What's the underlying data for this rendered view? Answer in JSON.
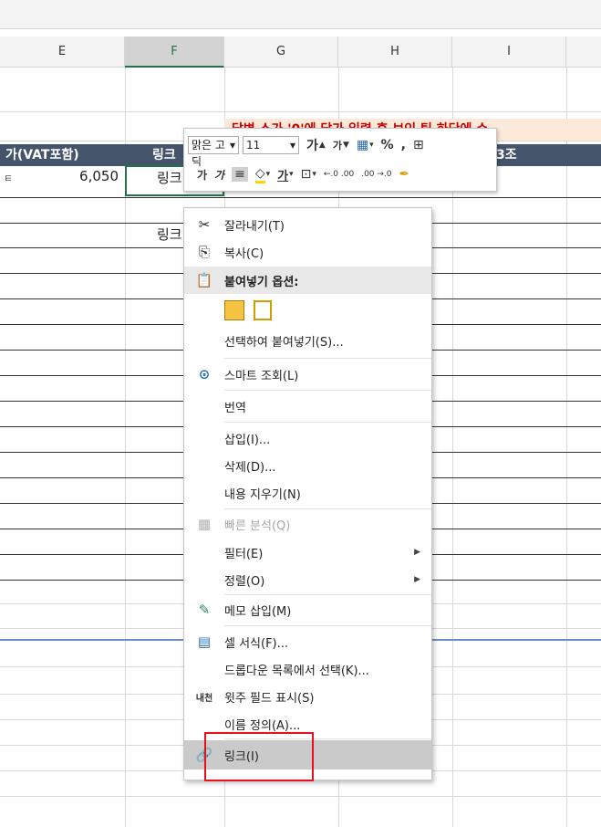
{
  "columns": [
    {
      "letter": "E",
      "selected": false
    },
    {
      "letter": "F",
      "selected": true
    },
    {
      "letter": "G",
      "selected": false
    },
    {
      "letter": "H",
      "selected": false
    },
    {
      "letter": "I",
      "selected": false
    }
  ],
  "sheet": {
    "banner_text": "담변 소가 '0'에 담가 입력 후 보인 팀 하단에 수",
    "header_price": "가(VAT포함)",
    "header_link": "링크",
    "header_right": "3조",
    "row1_price": "6,050",
    "row1_left_mark": "ㅌ",
    "row1_link": "링크",
    "row2_link": "링크"
  },
  "mini_toolbar": {
    "font_name": "맑은 고딕",
    "font_size": "11",
    "grow_font": "가",
    "shrink_font": "가",
    "percent": "%",
    "comma": ",",
    "bold": "가",
    "italic": "가",
    "underline_color_letter": "가",
    "inc_decimal": "←.0 .00",
    "dec_decimal": ".00 →.0"
  },
  "context_menu": {
    "items": [
      {
        "label": "잘라내기(T)",
        "icon": "scissors-icon",
        "glyph": "✂"
      },
      {
        "label": "복사(C)",
        "icon": "copy-icon",
        "glyph": "⎘"
      },
      {
        "label": "붙여넣기 옵션:",
        "icon": "paste-icon",
        "glyph": "📋",
        "section": true
      },
      {
        "label": "",
        "icon": "paste-option-icons",
        "glyph": ""
      },
      {
        "label": "선택하여 붙여넣기(S)...",
        "icon": "",
        "glyph": ""
      },
      {
        "label": "스마트 조회(L)",
        "icon": "smart-lookup-icon",
        "glyph": "⊙"
      },
      {
        "label": "번역",
        "icon": "",
        "glyph": ""
      },
      {
        "label": "삽입(I)...",
        "icon": "",
        "glyph": ""
      },
      {
        "label": "삭제(D)...",
        "icon": "",
        "glyph": ""
      },
      {
        "label": "내용 지우기(N)",
        "icon": "",
        "glyph": ""
      },
      {
        "label": "빠른 분석(Q)",
        "icon": "quick-analysis-icon",
        "glyph": "▦",
        "disabled": true
      },
      {
        "label": "필터(E)",
        "icon": "",
        "glyph": "",
        "submenu": true
      },
      {
        "label": "정렬(O)",
        "icon": "",
        "glyph": "",
        "submenu": true
      },
      {
        "label": "메모 삽입(M)",
        "icon": "insert-comment-icon",
        "glyph": "✎"
      },
      {
        "label": "셀 서식(F)...",
        "icon": "format-cells-icon",
        "glyph": "▤"
      },
      {
        "label": "드롭다운 목록에서 선택(K)...",
        "icon": "",
        "glyph": ""
      },
      {
        "label": "윗주 필드 표시(S)",
        "icon": "phonetic-icon",
        "glyph": "내천"
      },
      {
        "label": "이름 정의(A)...",
        "icon": "",
        "glyph": ""
      },
      {
        "label": "링크(I)",
        "icon": "link-icon",
        "glyph": "🔗",
        "hover": true
      }
    ]
  }
}
